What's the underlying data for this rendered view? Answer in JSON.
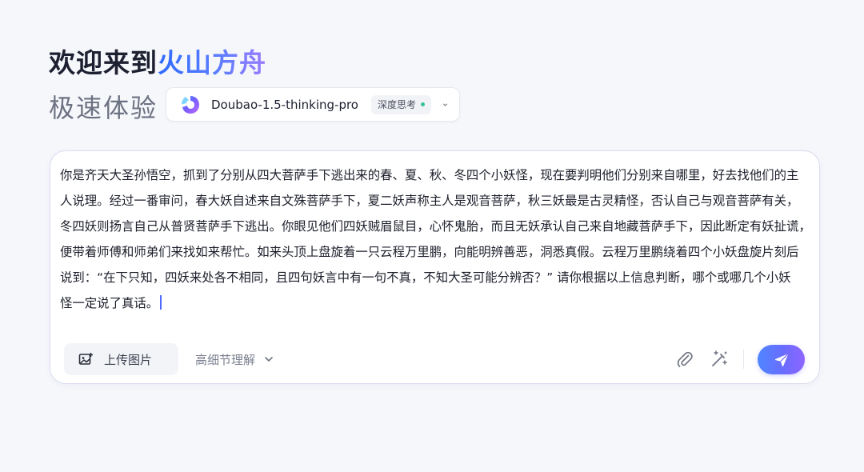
{
  "header": {
    "welcome_prefix": "欢迎来到",
    "brand": "火山方舟",
    "subtitle": "极速体验"
  },
  "model_select": {
    "logo_icon": "doubao-logo-icon",
    "model_name": "Doubao-1.5-thinking-pro",
    "mode_badge": "深度思考",
    "badge_status_color": "#34c38f",
    "chevron_icon": "chevron-down-icon"
  },
  "composer": {
    "prompt_lines": [
      "你是齐天大圣孙悟空，抓到了分别从四大菩萨手下逃出来的春、夏、秋、冬四个小妖怪，现在要判明他们分别来自哪里，好去找他们的主",
      "人说理。经过一番审问，春大妖自述来自文殊菩萨手下，夏二妖声称主人是观音菩萨，秋三妖最是古灵精怪，否认自己与观音菩萨有关，",
      "冬四妖则扬言自己从普贤菩萨手下逃出。你眼见他们四妖贼眉鼠目，心怀鬼胎，而且无妖承认自己来自地藏菩萨手下，因此断定有妖扯谎，",
      "便带着师傅和师弟们来找如来帮忙。如来头顶上盘旋着一只云程万里鹏，向能明辨善恶，洞悉真假。云程万里鹏绕着四个小妖盘旋片刻后",
      "说到：“在下只知，四妖来处各不相同，且四句妖言中有一句不真，不知大圣可能分辨否？” 请你根据以上信息判断，哪个或哪几个小妖",
      "怪一定说了真话。"
    ],
    "upload_label": "上传图片",
    "upload_icon": "image-upload-icon",
    "detail_mode": "高细节理解",
    "attach_icon": "paperclip-icon",
    "magic_icon": "magic-wand-icon",
    "send_icon": "send-icon",
    "accent_color": "#6a6cff"
  }
}
